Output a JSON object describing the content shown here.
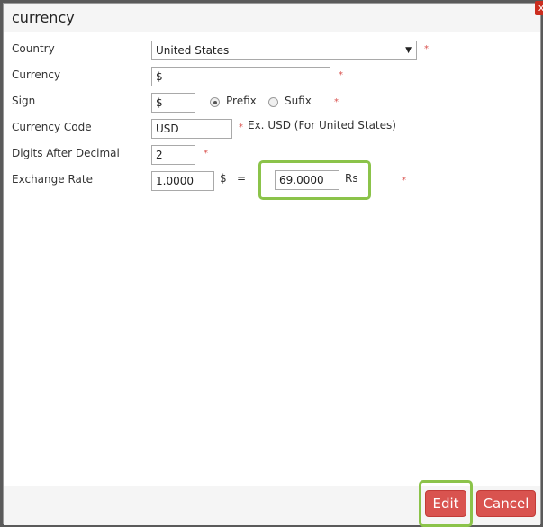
{
  "dialog": {
    "title": "currency",
    "close_glyph": "x"
  },
  "form": {
    "country": {
      "label": "Country",
      "value": "United States"
    },
    "currency": {
      "label": "Currency",
      "value": "$"
    },
    "sign": {
      "label": "Sign",
      "value": "$",
      "prefix_label": "Prefix",
      "suffix_label": "Sufix",
      "selected": "Prefix"
    },
    "currency_code": {
      "label": "Currency Code",
      "value": "USD",
      "hint": "Ex. USD (For United States)"
    },
    "digits": {
      "label": "Digits After Decimal",
      "value": "2"
    },
    "exchange": {
      "label": "Exchange Rate",
      "base_value": "1.0000",
      "base_symbol": "$",
      "equals": "=",
      "target_value": "69.0000",
      "target_symbol": "Rs"
    },
    "required_marker": "*"
  },
  "footer": {
    "edit_label": "Edit",
    "cancel_label": "Cancel"
  },
  "colors": {
    "primary_button": "#d9534f",
    "highlight": "#8bc34a",
    "required": "#d9534f"
  }
}
